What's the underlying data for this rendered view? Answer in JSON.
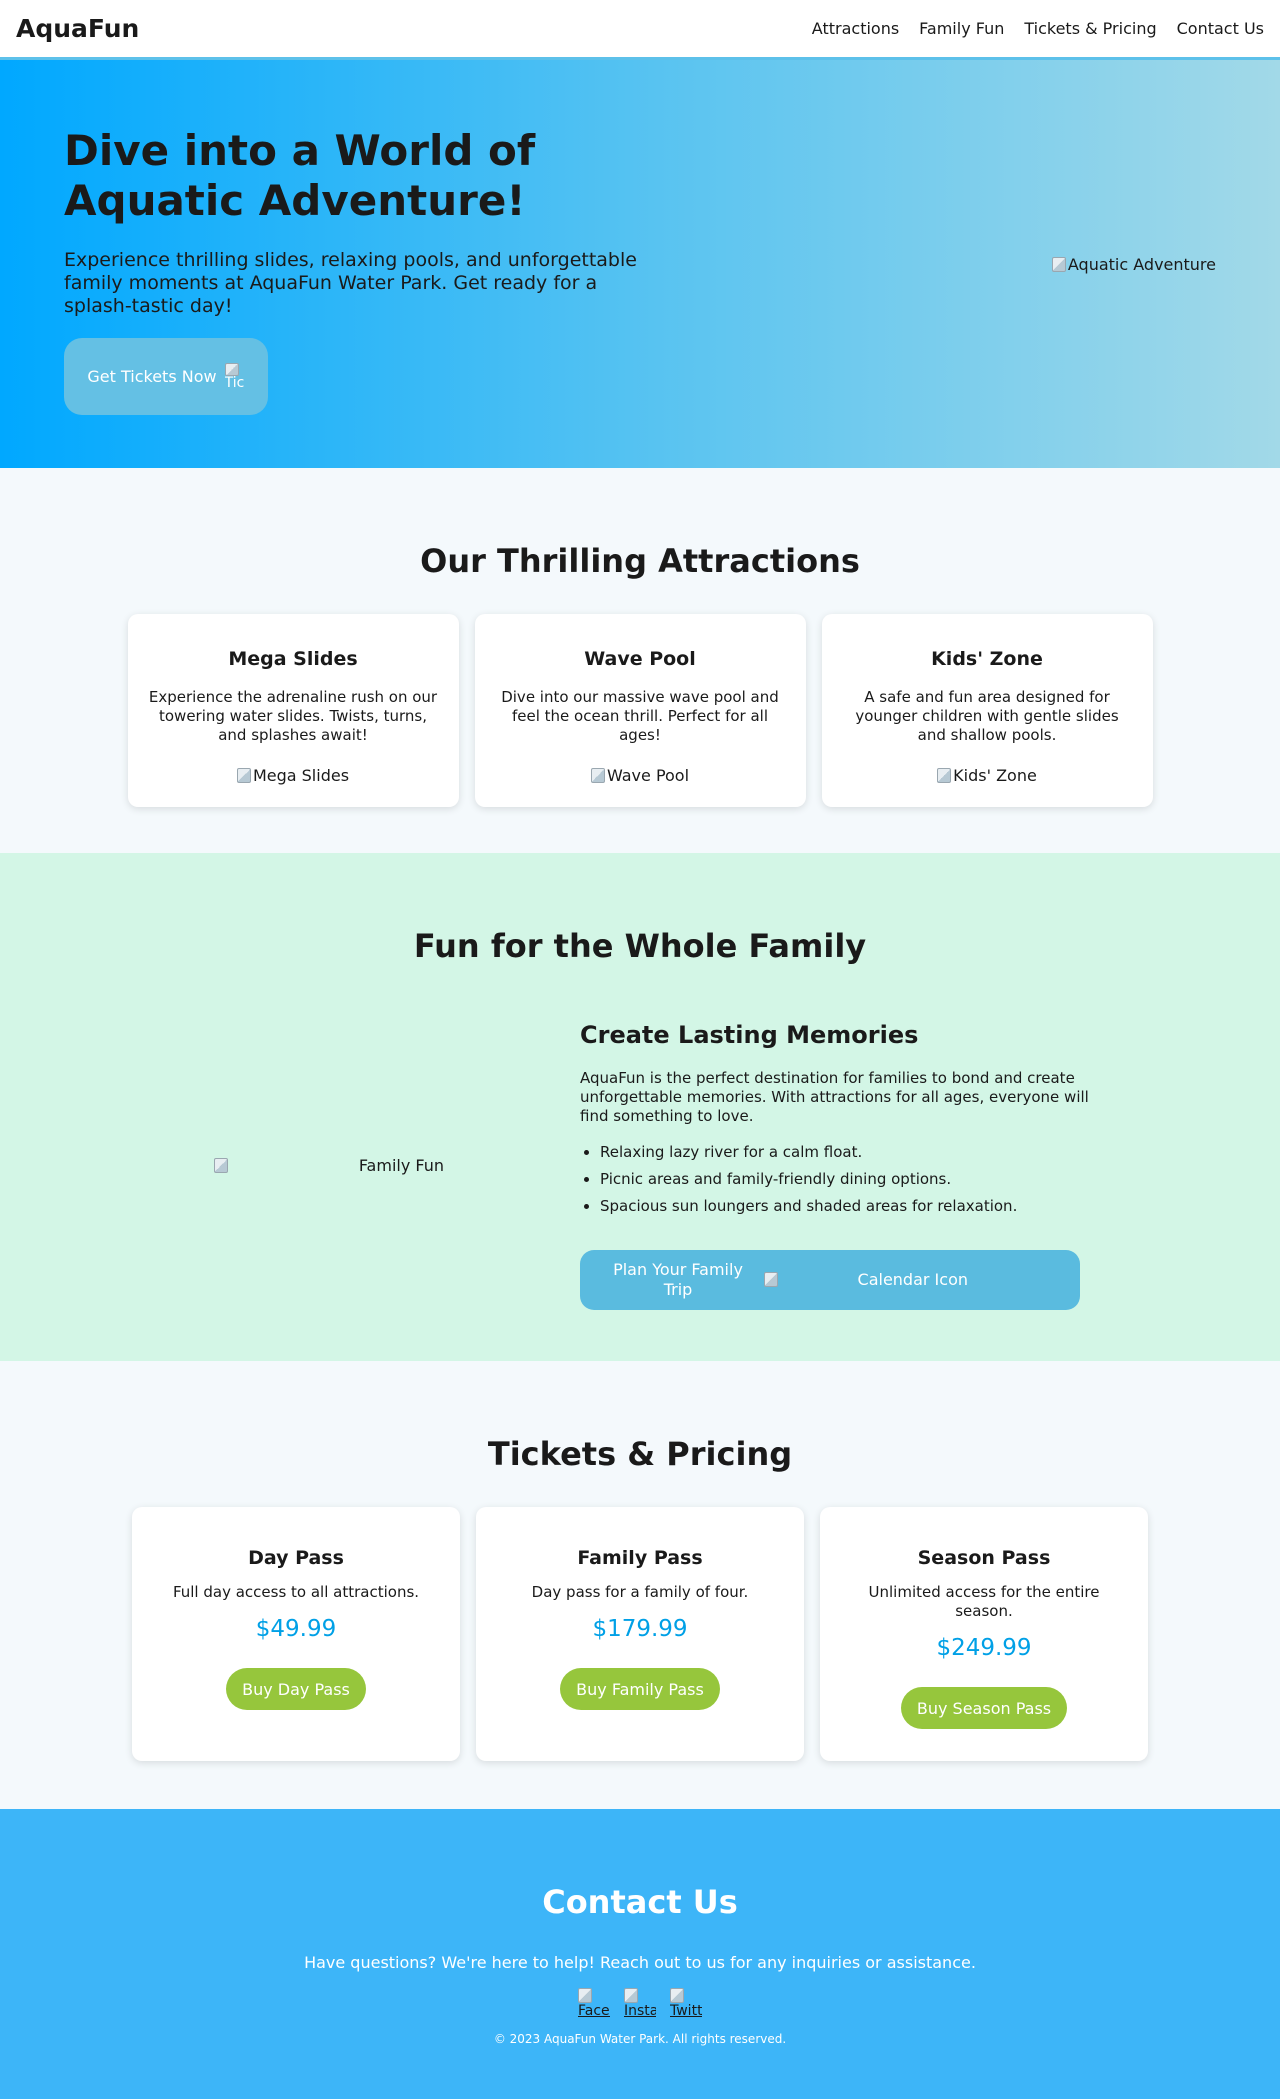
{
  "header": {
    "logo": "AquaFun",
    "nav": [
      "Attractions",
      "Family Fun",
      "Tickets & Pricing",
      "Contact Us"
    ]
  },
  "hero": {
    "title": "Dive into a World of Aquatic Adventure!",
    "description": "Experience thrilling slides, relaxing pools, and unforgettable family moments at AquaFun Water Park. Get ready for a splash-tastic day!",
    "button_label": "Get Tickets Now",
    "button_icon_alt": "Ticket Icon",
    "image_alt": "Aquatic Adventure"
  },
  "attractions": {
    "title": "Our Thrilling Attractions",
    "cards": [
      {
        "title": "Mega Slides",
        "description": "Experience the adrenaline rush on our towering water slides. Twists, turns, and splashes await!",
        "image_alt": "Mega Slides"
      },
      {
        "title": "Wave Pool",
        "description": "Dive into our massive wave pool and feel the ocean thrill. Perfect for all ages!",
        "image_alt": "Wave Pool"
      },
      {
        "title": "Kids' Zone",
        "description": "A safe and fun area designed for younger children with gentle slides and shallow pools.",
        "image_alt": "Kids' Zone"
      }
    ]
  },
  "family": {
    "title": "Fun for the Whole Family",
    "image_alt": "Family Fun",
    "heading": "Create Lasting Memories",
    "description": "AquaFun is the perfect destination for families to bond and create unforgettable memories. With attractions for all ages, everyone will find something to love.",
    "list": [
      "Relaxing lazy river for a calm float.",
      "Picnic areas and family-friendly dining options.",
      "Spacious sun loungers and shaded areas for relaxation."
    ],
    "button_label": "Plan Your Family Trip",
    "button_icon_alt": "Calendar Icon"
  },
  "pricing": {
    "title": "Tickets & Pricing",
    "cards": [
      {
        "title": "Day Pass",
        "description": "Full day access to all attractions.",
        "price": "$49.99",
        "button": "Buy Day Pass"
      },
      {
        "title": "Family Pass",
        "description": "Day pass for a family of four.",
        "price": "$179.99",
        "button": "Buy Family Pass"
      },
      {
        "title": "Season Pass",
        "description": "Unlimited access for the entire season.",
        "price": "$249.99",
        "button": "Buy Season Pass"
      }
    ]
  },
  "contact": {
    "title": "Contact Us",
    "description": "Have questions? We're here to help! Reach out to us for any inquiries or assistance.",
    "socials": [
      "Facebook",
      "Instagram",
      "Twitter"
    ],
    "copyright": "© 2023 AquaFun Water Park. All rights reserved."
  },
  "colors": {
    "hero_gradient_start": "#00a8ff",
    "hero_gradient_end": "#a2d9e8",
    "family_bg": "#d3f6e6",
    "price_accent": "#00a0e6",
    "buy_button": "#96c63c",
    "contact_bg": "#3db5f8"
  }
}
